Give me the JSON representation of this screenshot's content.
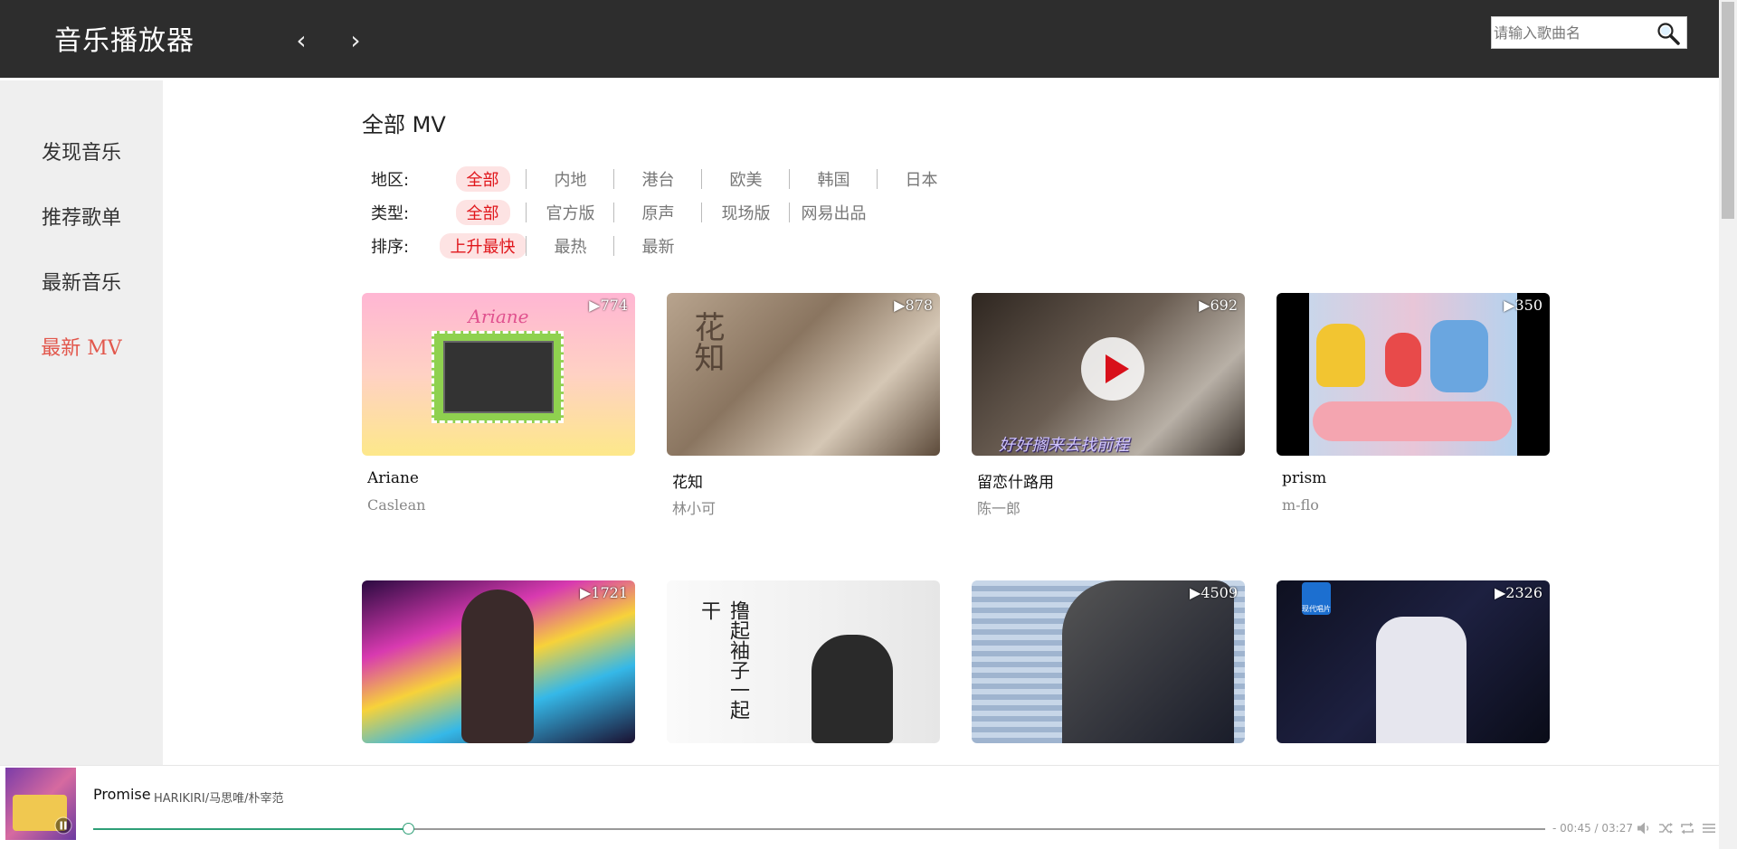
{
  "header": {
    "app_title": "音乐播放器",
    "back_glyph": "‹",
    "forward_glyph": "›",
    "search_placeholder": "请输入歌曲名",
    "search_icon": "search-icon"
  },
  "sidebar": {
    "items": [
      {
        "label": "发现音乐"
      },
      {
        "label": "推荐歌单"
      },
      {
        "label": "最新音乐"
      },
      {
        "label": "最新 MV",
        "active": true
      }
    ],
    "active_color": "#e2574c"
  },
  "main": {
    "heading": "全部 MV",
    "filters": [
      {
        "label": "地区:",
        "options": [
          "全部",
          "内地",
          "港台",
          "欧美",
          "韩国",
          "日本"
        ],
        "selected": "全部"
      },
      {
        "label": "类型:",
        "options": [
          "全部",
          "官方版",
          "原声",
          "现场版",
          "网易出品"
        ],
        "selected": "全部"
      },
      {
        "label": "排序:",
        "options": [
          "上升最快",
          "最热",
          "最新"
        ],
        "selected": "上升最快"
      }
    ],
    "mvs": [
      {
        "name": "Ariane",
        "artist": "Caslean",
        "play_count": "▶774",
        "thumb_text": "Ariane"
      },
      {
        "name": "花知",
        "artist": "林小可",
        "play_count": "▶878",
        "thumb_text": "花知"
      },
      {
        "name": "留恋什路用",
        "artist": "陈一郎",
        "play_count": "▶692",
        "thumb_text": "好好搁来去找前程"
      },
      {
        "name": "prism",
        "artist": "m-flo",
        "play_count": "▶350",
        "thumb_text": ""
      },
      {
        "name": "",
        "artist": "",
        "play_count": "▶1721",
        "thumb_text": ""
      },
      {
        "name": "",
        "artist": "",
        "play_count": "",
        "thumb_text": "撸起袖子一起干"
      },
      {
        "name": "",
        "artist": "",
        "play_count": "▶4509",
        "thumb_text": ""
      },
      {
        "name": "",
        "artist": "",
        "play_count": "▶2326",
        "thumb_text": "现代唱片"
      }
    ]
  },
  "player": {
    "song_title": "Promise",
    "song_artist": "HARIKIRI/马思唯/朴宰范",
    "time": "- 00:45 / 03:27",
    "progress": 0.217,
    "accent_color": "#2e9f77",
    "controls": [
      "volume-icon",
      "shuffle-icon",
      "repeat-icon",
      "playlist-icon"
    ]
  }
}
